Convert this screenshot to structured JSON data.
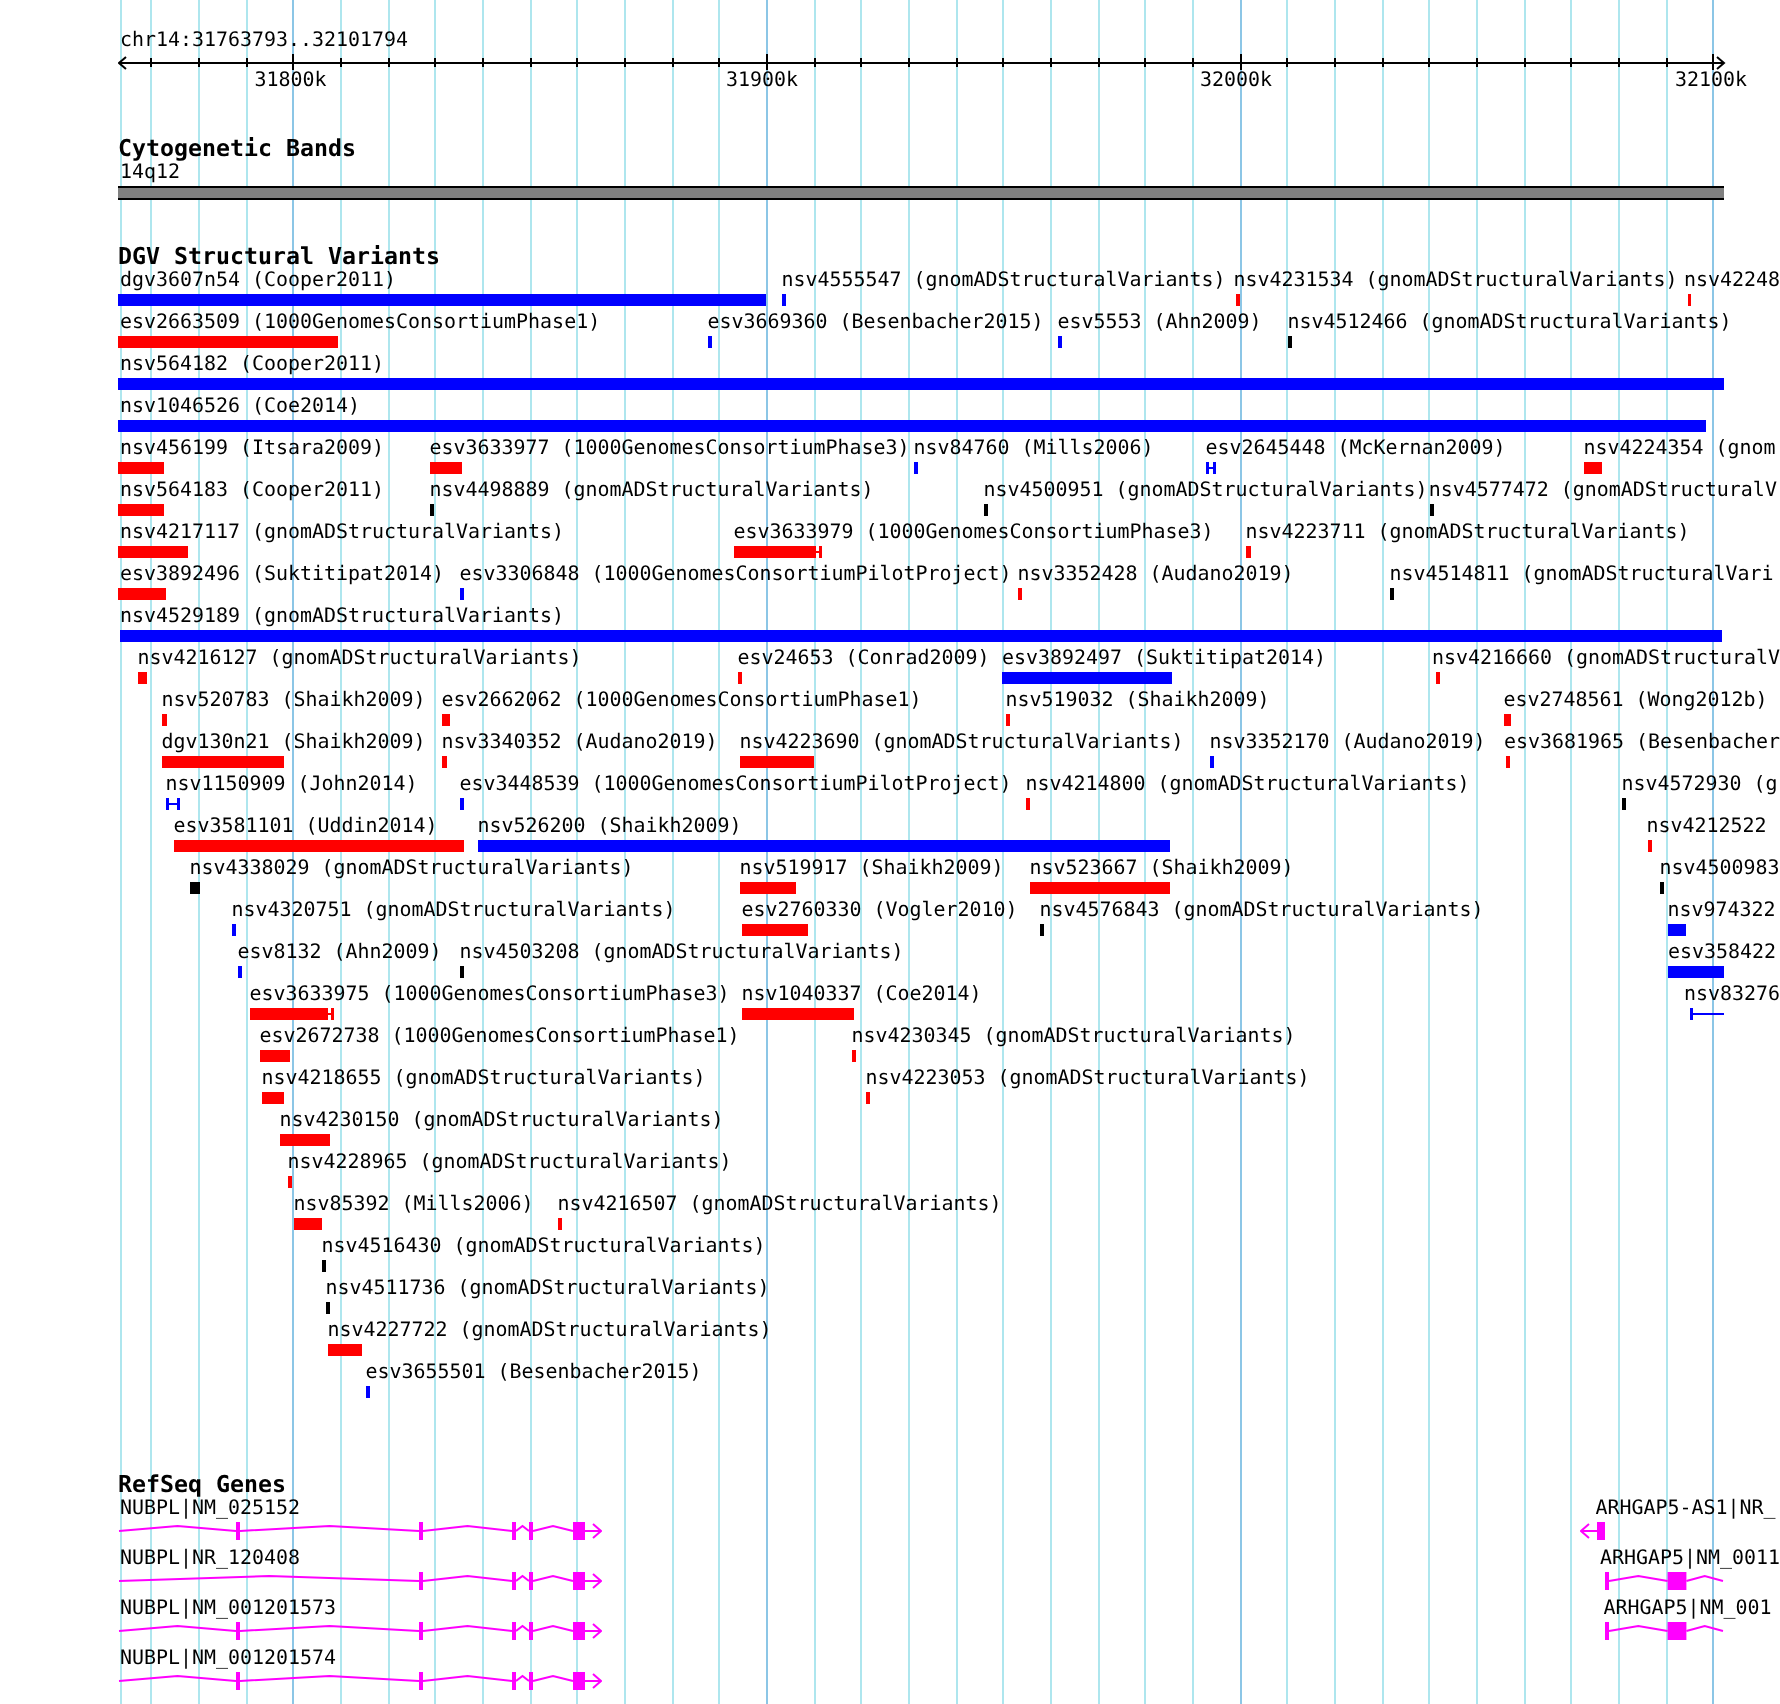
{
  "ruler": {
    "title": "chr14:31763793..32101794",
    "ticks": [
      "31800k",
      "31900k",
      "32000k",
      "32100k"
    ]
  },
  "tracks": [
    {
      "kind": "cytoband",
      "title": "Cytogenetic Bands",
      "band": {
        "label": "14q12"
      }
    },
    {
      "kind": "variants",
      "title": "DGV Structural Variants",
      "rows": [
        {
          "features": [
            {
              "label": "dgv3607n54 (Cooper2011)",
              "color": "#0000ff"
            },
            {
              "label": "nsv4555547 (gnomADStructuralVariants)",
              "color": "#0000ff"
            },
            {
              "label": "nsv4231534 (gnomADStructuralVariants)",
              "color": "#ff0000"
            },
            {
              "label": "nsv42248",
              "color": "#ff0000"
            }
          ]
        },
        {
          "features": [
            {
              "label": "esv2663509 (1000GenomesConsortiumPhase1)",
              "color": "#ff0000"
            },
            {
              "label": "esv3669360 (Besenbacher2015)",
              "color": "#0000ff"
            },
            {
              "label": "esv5553 (Ahn2009)",
              "color": "#0000ff"
            },
            {
              "label": "nsv4512466 (gnomADStructuralVariants)",
              "color": "#000000"
            }
          ]
        },
        {
          "features": [
            {
              "label": "nsv564182 (Cooper2011)",
              "color": "#0000ff"
            }
          ]
        },
        {
          "features": [
            {
              "label": "nsv1046526 (Coe2014)",
              "color": "#0000ff"
            }
          ]
        },
        {
          "features": [
            {
              "label": "nsv456199 (Itsara2009)",
              "color": "#ff0000"
            },
            {
              "label": "esv3633977 (1000GenomesConsortiumPhase3)",
              "color": "#ff0000"
            },
            {
              "label": "nsv84760 (Mills2006)",
              "color": "#0000ff"
            },
            {
              "label": "esv2645448 (McKernan2009)",
              "color": "#0000ff"
            },
            {
              "label": "nsv4224354 (gnom",
              "color": "#ff0000"
            }
          ]
        },
        {
          "features": [
            {
              "label": "nsv564183 (Cooper2011)",
              "color": "#ff0000"
            },
            {
              "label": "nsv4498889 (gnomADStructuralVariants)",
              "color": "#000000"
            },
            {
              "label": "nsv4500951 (gnomADStructuralVariants)",
              "color": "#000000"
            },
            {
              "label": "nsv4577472 (gnomADStructuralV",
              "color": "#000000"
            }
          ]
        },
        {
          "features": [
            {
              "label": "nsv4217117 (gnomADStructuralVariants)",
              "color": "#ff0000"
            },
            {
              "label": "esv3633979 (1000GenomesConsortiumPhase3)",
              "color": "#ff0000"
            },
            {
              "label": "nsv4223711 (gnomADStructuralVariants)",
              "color": "#ff0000"
            }
          ]
        },
        {
          "features": [
            {
              "label": "esv3892496 (Suktitipat2014)",
              "color": "#ff0000"
            },
            {
              "label": "esv3306848 (1000GenomesConsortiumPilotProject)",
              "color": "#0000ff"
            },
            {
              "label": "nsv3352428 (Audano2019)",
              "color": "#ff0000"
            },
            {
              "label": "nsv4514811 (gnomADStructuralVari",
              "color": "#000000"
            }
          ]
        },
        {
          "features": [
            {
              "label": "nsv4529189 (gnomADStructuralVariants)",
              "color": "#0000ff"
            }
          ]
        },
        {
          "features": [
            {
              "label": "nsv4216127 (gnomADStructuralVariants)",
              "color": "#ff0000"
            },
            {
              "label": "esv24653 (Conrad2009)",
              "color": "#ff0000"
            },
            {
              "label": "esv3892497 (Suktitipat2014)",
              "color": "#0000ff"
            },
            {
              "label": "nsv4216660 (gnomADStructuralV",
              "color": "#ff0000"
            }
          ]
        },
        {
          "features": [
            {
              "label": "nsv520783 (Shaikh2009)",
              "color": "#ff0000"
            },
            {
              "label": "esv2662062 (1000GenomesConsortiumPhase1)",
              "color": "#ff0000"
            },
            {
              "label": "nsv519032 (Shaikh2009)",
              "color": "#ff0000"
            },
            {
              "label": "esv2748561 (Wong2012b)",
              "color": "#ff0000"
            }
          ]
        },
        {
          "features": [
            {
              "label": "dgv130n21 (Shaikh2009)",
              "color": "#ff0000"
            },
            {
              "label": "nsv3340352 (Audano2019)",
              "color": "#ff0000"
            },
            {
              "label": "nsv4223690 (gnomADStructuralVariants)",
              "color": "#ff0000"
            },
            {
              "label": "nsv3352170 (Audano2019)",
              "color": "#0000ff"
            },
            {
              "label": "esv3681965 (Besenbacher",
              "color": "#ff0000"
            }
          ]
        },
        {
          "features": [
            {
              "label": "nsv1150909 (John2014)",
              "color": "#0000ff"
            },
            {
              "label": "esv3448539 (1000GenomesConsortiumPilotProject)",
              "color": "#0000ff"
            },
            {
              "label": "nsv4214800 (gnomADStructuralVariants)",
              "color": "#ff0000"
            },
            {
              "label": "nsv4572930 (g",
              "color": "#000000"
            }
          ]
        },
        {
          "features": [
            {
              "label": "esv3581101 (Uddin2014)",
              "color": "#ff0000"
            },
            {
              "label": "nsv526200 (Shaikh2009)",
              "color": "#0000ff"
            },
            {
              "label": "nsv4212522",
              "color": "#ff0000"
            }
          ]
        },
        {
          "features": [
            {
              "label": "nsv4338029 (gnomADStructuralVariants)",
              "color": "#000000"
            },
            {
              "label": "nsv519917 (Shaikh2009)",
              "color": "#ff0000"
            },
            {
              "label": "nsv523667 (Shaikh2009)",
              "color": "#ff0000"
            },
            {
              "label": "nsv4500983",
              "color": "#000000"
            }
          ]
        },
        {
          "features": [
            {
              "label": "nsv4320751 (gnomADStructuralVariants)",
              "color": "#0000ff"
            },
            {
              "label": "esv2760330 (Vogler2010)",
              "color": "#ff0000"
            },
            {
              "label": "nsv4576843 (gnomADStructuralVariants)",
              "color": "#000000"
            },
            {
              "label": "nsv974322",
              "color": "#0000ff"
            }
          ]
        },
        {
          "features": [
            {
              "label": "esv8132 (Ahn2009)",
              "color": "#0000ff"
            },
            {
              "label": "nsv4503208 (gnomADStructuralVariants)",
              "color": "#000000"
            },
            {
              "label": "esv358422",
              "color": "#0000ff"
            }
          ]
        },
        {
          "features": [
            {
              "label": "esv3633975 (1000GenomesConsortiumPhase3)",
              "color": "#ff0000"
            },
            {
              "label": "nsv1040337 (Coe2014)",
              "color": "#ff0000"
            },
            {
              "label": "nsv83276",
              "color": "#0000ff"
            }
          ]
        },
        {
          "features": [
            {
              "label": "esv2672738 (1000GenomesConsortiumPhase1)",
              "color": "#ff0000"
            },
            {
              "label": "nsv4230345 (gnomADStructuralVariants)",
              "color": "#ff0000"
            }
          ]
        },
        {
          "features": [
            {
              "label": "nsv4218655 (gnomADStructuralVariants)",
              "color": "#ff0000"
            },
            {
              "label": "nsv4223053 (gnomADStructuralVariants)",
              "color": "#ff0000"
            }
          ]
        },
        {
          "features": [
            {
              "label": "nsv4230150 (gnomADStructuralVariants)",
              "color": "#ff0000"
            }
          ]
        },
        {
          "features": [
            {
              "label": "nsv4228965 (gnomADStructuralVariants)",
              "color": "#ff0000"
            }
          ]
        },
        {
          "features": [
            {
              "label": "nsv85392 (Mills2006)",
              "color": "#ff0000"
            },
            {
              "label": "nsv4216507 (gnomADStructuralVariants)",
              "color": "#ff0000"
            }
          ]
        },
        {
          "features": [
            {
              "label": "nsv4516430 (gnomADStructuralVariants)",
              "color": "#000000"
            }
          ]
        },
        {
          "features": [
            {
              "label": "nsv4511736 (gnomADStructuralVariants)",
              "color": "#000000"
            }
          ]
        },
        {
          "features": [
            {
              "label": "nsv4227722 (gnomADStructuralVariants)",
              "color": "#ff0000"
            }
          ]
        },
        {
          "features": [
            {
              "label": "esv3655501 (Besenbacher2015)",
              "color": "#0000ff"
            }
          ]
        }
      ]
    },
    {
      "kind": "genes",
      "title": "RefSeq Genes",
      "rows": [
        {
          "genes": [
            {
              "label": "NUBPL|NM_025152",
              "arrow_right": true,
              "arrow_left": false
            },
            {
              "label": "ARHGAP5-AS1|NR_",
              "arrow_right": false,
              "arrow_left": true
            }
          ]
        },
        {
          "genes": [
            {
              "label": "NUBPL|NR_120408",
              "arrow_right": true,
              "arrow_left": false
            },
            {
              "label": "ARHGAP5|NM_0011",
              "arrow_right": false,
              "arrow_left": false
            }
          ]
        },
        {
          "genes": [
            {
              "label": "NUBPL|NM_001201573",
              "arrow_right": true,
              "arrow_left": false
            },
            {
              "label": "ARHGAP5|NM_001",
              "arrow_right": false,
              "arrow_left": false
            }
          ]
        },
        {
          "genes": [
            {
              "label": "NUBPL|NM_001201574",
              "arrow_right": true,
              "arrow_left": false
            }
          ]
        }
      ]
    }
  ]
}
